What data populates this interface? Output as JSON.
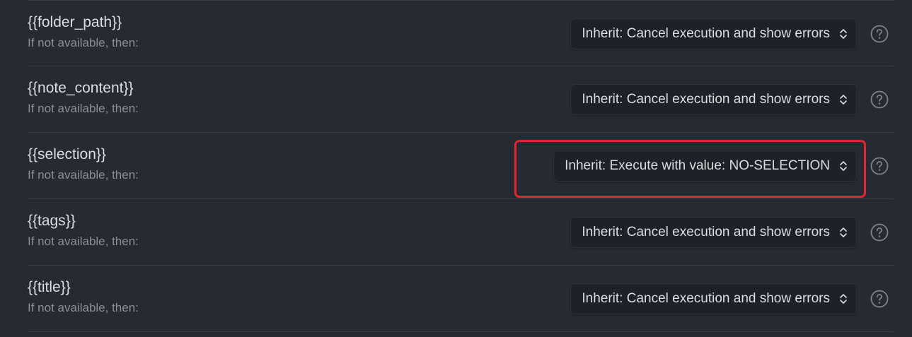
{
  "rows": [
    {
      "variable": "{{folder_path}}",
      "description": "If not available, then:",
      "selected_option": "Inherit: Cancel execution and show errors"
    },
    {
      "variable": "{{note_content}}",
      "description": "If not available, then:",
      "selected_option": "Inherit: Cancel execution and show errors"
    },
    {
      "variable": "{{selection}}",
      "description": "If not available, then:",
      "selected_option": "Inherit: Execute with value: NO-SELECTION"
    },
    {
      "variable": "{{tags}}",
      "description": "If not available, then:",
      "selected_option": "Inherit: Cancel execution and show errors"
    },
    {
      "variable": "{{title}}",
      "description": "If not available, then:",
      "selected_option": "Inherit: Cancel execution and show errors"
    }
  ],
  "icons": {
    "dropdown": "chevron-up-down-icon",
    "help": "help-circle-icon"
  },
  "colors": {
    "background": "#262a33",
    "select_background": "#1e2129",
    "text_primary": "#dcddde",
    "text_muted": "#8a8e96",
    "divider": "#3a3f49",
    "highlight": "#e0262f"
  }
}
